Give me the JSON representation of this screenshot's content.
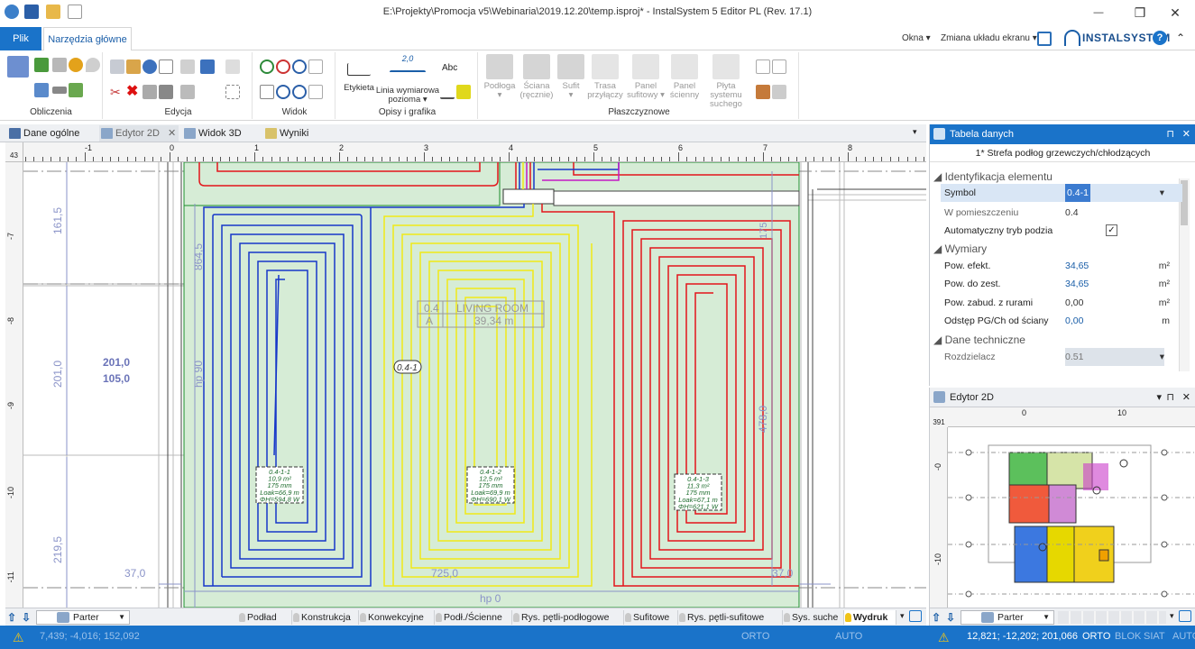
{
  "window": {
    "title": "E:\\Projekty\\Promocja v5\\Webinaria\\2019.12.20\\temp.isproj* - InstalSystem 5 Editor PL (Rev. 17.1)",
    "minimize": "—",
    "maximize": "❒",
    "close": "✕"
  },
  "ribbon_tabs": {
    "file": "Plik",
    "home": "Narzędzia główne",
    "okna": "Okna ▾",
    "layout": "Zmiana układu ekranu ▾",
    "brand": "INSTALSYSTEM",
    "help": "?"
  },
  "ribbon_groups": {
    "obliczenia": "Obliczenia",
    "edycja": "Edycja",
    "widok": "Widok",
    "opisy": "Opisy i grafika",
    "plaszczyznowe": "Płaszczyznowe"
  },
  "ribbon_buttons": {
    "etykieta": "Etykieta",
    "linia1": "Linia wymiarowa",
    "linia2": "pozioma ▾",
    "dim_value": "2,0",
    "abc": "Abc",
    "podloga": "Podłoga",
    "sciana1": "Ściana",
    "sciana2": "(ręcznie)",
    "sufit": "Sufit",
    "trasa1": "Trasa",
    "trasa2": "przyłączy",
    "panel_sufit1": "Panel",
    "panel_sufit2": "sufitowy ▾",
    "panel_scien1": "Panel",
    "panel_scien2": "ścienny",
    "plyta1": "Płyta systemu",
    "plyta2": "suchego"
  },
  "doc_tabs": {
    "dane": "Dane ogólne",
    "edytor": "Edytor 2D",
    "widok3d": "Widok 3D",
    "wyniki": "Wyniki"
  },
  "ruler": {
    "scale": "43",
    "x_ticks": [
      "-1",
      "0",
      "1",
      "2",
      "3",
      "4",
      "5",
      "6",
      "7",
      "8"
    ],
    "y_ticks": [
      "-7",
      "-8",
      "-9",
      "-10",
      "-11"
    ]
  },
  "drawing": {
    "dim_left_1": "161,5",
    "dim_left_2": "201,0",
    "dim_left_3": "219,5",
    "dim_mid_1": "201,0",
    "dim_mid_2": "105,0",
    "dim_864": "864,5",
    "hp90": "hp 90",
    "dim_175": "175",
    "dim_478": "478,0",
    "dim_37a": "37,0",
    "dim_37b": "37,0",
    "dim_725": "725,0",
    "hp0": "hp 0",
    "room_id": "0.4",
    "room_name": "LIVING ROOM",
    "room_a": "A",
    "room_area": "39,34 m",
    "zone_tag": "0.4-1",
    "loop1": [
      "0.4-1-1",
      "10,9 m²",
      "175 mm",
      "Loak=66,9 m",
      "ΦH=594,8 W"
    ],
    "loop2": [
      "0.4-1-2",
      "12,5 m²",
      "175 mm",
      "Loak=69,9 m",
      "ΦH=690,1 W"
    ],
    "loop3": [
      "0.4-1-3",
      "11,3 m²",
      "175 mm",
      "Loak=67,1 m",
      "ΦH=621,1 W"
    ]
  },
  "layer_tabs": [
    "Podład",
    "Konstrukcja",
    "Konwekcyjne",
    "Podł./Ścienne",
    "Rys. pętli-podłogowe",
    "Sufitowe",
    "Rys. pętli-sufitowe",
    "Sys. suche",
    "Wydruk"
  ],
  "floor_select": "Parter",
  "data_panel": {
    "title": "Tabela danych",
    "subject": "1* Strefa podłog grzewczych/chłodzących",
    "cat1": "Identyfikacja elementu",
    "symbol_label": "Symbol",
    "symbol_value": "0.4-1",
    "room_label": "W pomieszczeniu",
    "room_value": "0.4",
    "auto_label": "Automatyczny tryb podzia",
    "auto_check": "✓",
    "cat2": "Wymiary",
    "pow_ef_label": "Pow. efekt.",
    "pow_ef_value": "34,65",
    "pow_ef_unit": "m²",
    "pow_zest_label": "Pow. do zest.",
    "pow_zest_value": "34,65",
    "pow_zest_unit": "m²",
    "pow_zab_label": "Pow. zabud. z rurami",
    "pow_zab_value": "0,00",
    "pow_zab_unit": "m²",
    "odstep_label": "Odstęp PG/Ch od ściany",
    "odstep_value": "0,00",
    "odstep_unit": "m",
    "cat3": "Dane techniczne",
    "rozdz_label": "Rozdzielacz",
    "rozdz_value": "0.51"
  },
  "mini_panel": {
    "title": "Edytor 2D",
    "scale": "391",
    "x_ticks": [
      "0",
      "10"
    ],
    "y_ticks": [
      "-0",
      "-10"
    ],
    "floor": "Parter",
    "coords": "12,821; -12,202; 201,066"
  },
  "status": {
    "coords_left": "7,439; -4,016; 152,092",
    "orto": "ORTO",
    "blok": "BLOK",
    "siat": "SIAT",
    "auto": "AUTO"
  },
  "colors": {
    "accent": "#1a73c9",
    "zone_fill": "#d6ecd6",
    "loop_red": "#e3151a",
    "loop_blue": "#1637c9",
    "loop_yellow": "#f0ea16",
    "dim_text": "#8a93c8"
  }
}
